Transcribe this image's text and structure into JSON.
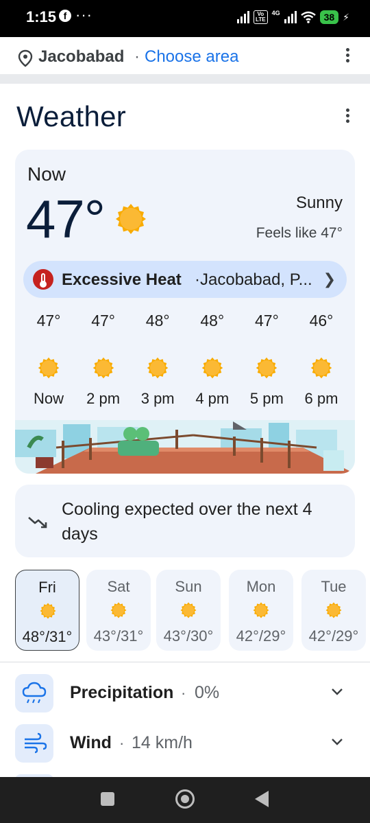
{
  "status_bar": {
    "time": "1:15",
    "facebook_icon": "facebook-icon",
    "more": "···",
    "volte": "Vo LTE",
    "network": "4G",
    "battery": "38"
  },
  "location": {
    "city": "Jacobabad",
    "separator": "·",
    "choose_area": "Choose area"
  },
  "header": {
    "title": "Weather"
  },
  "current": {
    "label": "Now",
    "temperature": "47°",
    "condition": "Sunny",
    "feels_like": "Feels like 47°"
  },
  "alert": {
    "title": "Excessive Heat",
    "separator": "·",
    "place": "Jacobabad, P..."
  },
  "hourly": [
    {
      "temp": "47°",
      "time": "Now",
      "icon": "sun-icon"
    },
    {
      "temp": "47°",
      "time": "2 pm",
      "icon": "sun-icon"
    },
    {
      "temp": "48°",
      "time": "3 pm",
      "icon": "sun-icon"
    },
    {
      "temp": "48°",
      "time": "4 pm",
      "icon": "sun-icon"
    },
    {
      "temp": "47°",
      "time": "5 pm",
      "icon": "sun-icon"
    },
    {
      "temp": "46°",
      "time": "6 pm",
      "icon": "sun-icon"
    }
  ],
  "trend": {
    "text": "Cooling expected over the next 4 days",
    "icon": "trending-down-icon"
  },
  "daily": [
    {
      "day": "Fri",
      "temps": "48°/31°",
      "selected": true
    },
    {
      "day": "Sat",
      "temps": "43°/31°",
      "selected": false
    },
    {
      "day": "Sun",
      "temps": "43°/30°",
      "selected": false
    },
    {
      "day": "Mon",
      "temps": "42°/29°",
      "selected": false
    },
    {
      "day": "Tue",
      "temps": "42°/29°",
      "selected": false
    }
  ],
  "details": {
    "precipitation": {
      "label": "Precipitation",
      "separator": "·",
      "value": "0%"
    },
    "wind": {
      "label": "Wind",
      "separator": "·",
      "value": "14 km/h"
    }
  },
  "colors": {
    "accent": "#1a73e8",
    "sun": "#f9a825",
    "alert": "#c5221f",
    "card": "#f0f4fb"
  }
}
